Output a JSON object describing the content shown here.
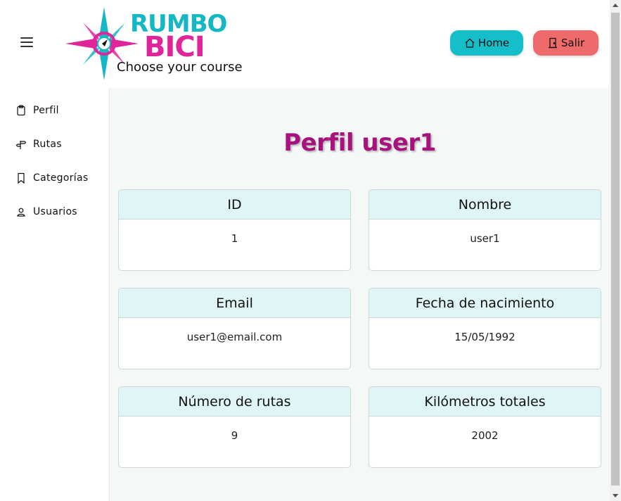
{
  "header": {
    "logo": {
      "line1": "RUMBO",
      "line2": "BICI",
      "tagline": "Choose your course"
    },
    "menu_icon": "hamburger-icon",
    "home_button": {
      "label": "Home",
      "icon": "home-icon",
      "color": "#14bfca"
    },
    "exit_button": {
      "label": "Salir",
      "icon": "door-icon",
      "color": "#ef6a6a"
    }
  },
  "sidebar": {
    "items": [
      {
        "label": "Perfil",
        "icon": "clipboard-icon"
      },
      {
        "label": "Rutas",
        "icon": "signpost-icon"
      },
      {
        "label": "Categorías",
        "icon": "bookmark-icon"
      },
      {
        "label": "Usuarios",
        "icon": "person-icon"
      }
    ]
  },
  "main": {
    "title": "Perfil user1",
    "title_color": "#a8127d",
    "cards": [
      {
        "label": "ID",
        "value": "1"
      },
      {
        "label": "Nombre",
        "value": "user1"
      },
      {
        "label": "Email",
        "value": "user1@email.com"
      },
      {
        "label": "Fecha de nacimiento",
        "value": "15/05/1992"
      },
      {
        "label": "Número de rutas",
        "value": "9"
      },
      {
        "label": "Kilómetros totales",
        "value": "2002"
      }
    ]
  }
}
